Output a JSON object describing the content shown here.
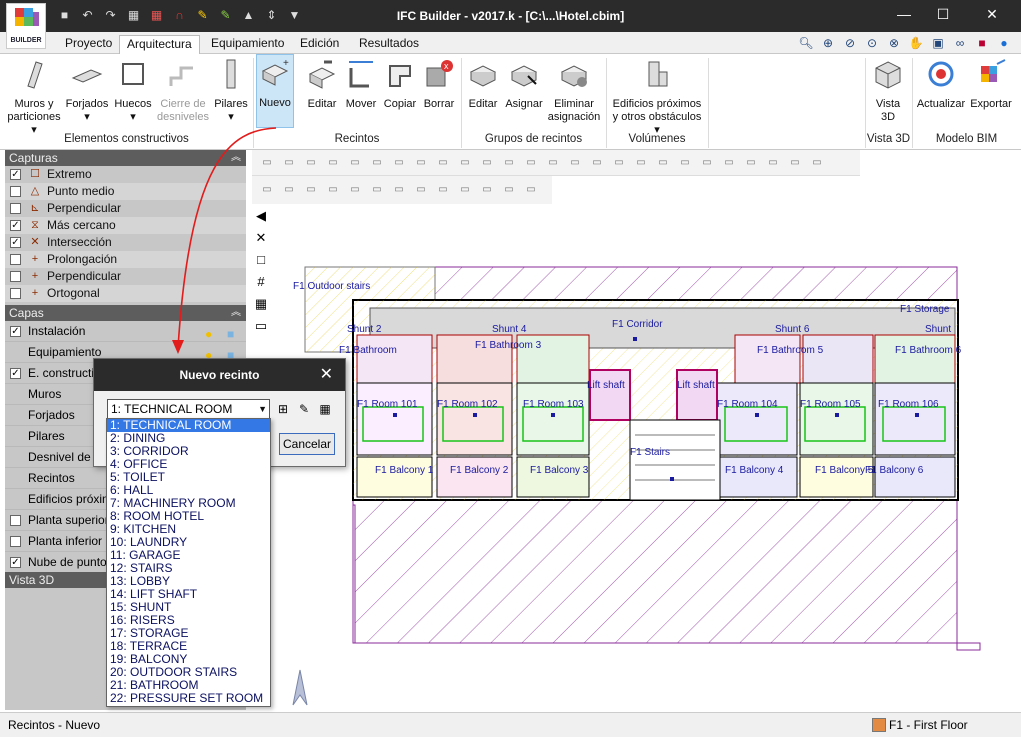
{
  "window": {
    "title": "IFC Builder - v2017.k - [C:\\...\\Hotel.cbim]",
    "logo_text": "BUILDER"
  },
  "menu_tabs": [
    "Proyecto",
    "Arquitectura",
    "Equipamiento",
    "Edición",
    "Resultados"
  ],
  "active_tab": "Arquitectura",
  "ribbon": {
    "buttons": {
      "muros": "Muros y\nparticiones",
      "forjados": "Forjados",
      "huecos": "Huecos",
      "cierre": "Cierre de\ndesniveles",
      "pilares": "Pilares",
      "nuevo": "Nuevo",
      "editar": "Editar",
      "mover": "Mover",
      "copiar": "Copiar",
      "borrar": "Borrar",
      "g_editar": "Editar",
      "asignar": "Asignar",
      "eliminar": "Eliminar\nasignación",
      "edificios": "Edificios próximos\ny otros obstáculos",
      "vista3d": "Vista\n3D",
      "actualizar": "Actualizar",
      "exportar": "Exportar"
    },
    "groups": {
      "elementos": "Elementos constructivos",
      "recintos": "Recintos",
      "grupos": "Grupos de recintos",
      "volumenes": "Volúmenes cercanos",
      "vista3d": "Vista 3D",
      "modelo": "Modelo BIM"
    }
  },
  "capturas": {
    "title": "Capturas",
    "items": [
      {
        "label": "Extremo",
        "checked": true,
        "icon": "square-snap-icon"
      },
      {
        "label": "Punto medio",
        "checked": false,
        "icon": "triangle-snap-icon"
      },
      {
        "label": "Perpendicular",
        "checked": false,
        "icon": "perpendicular-snap-icon"
      },
      {
        "label": "Más cercano",
        "checked": true,
        "icon": "hourglass-snap-icon"
      },
      {
        "label": "Intersección",
        "checked": true,
        "icon": "x-snap-icon"
      },
      {
        "label": "Prolongación",
        "checked": false,
        "icon": "plus-snap-icon"
      },
      {
        "label": "Perpendicular",
        "checked": false,
        "icon": "plus-snap-icon"
      },
      {
        "label": "Ortogonal",
        "checked": false,
        "icon": "plus-snap-icon"
      }
    ]
  },
  "capas": {
    "title": "Capas",
    "items": [
      {
        "label": "Instalación",
        "checked": true,
        "has_cb": true
      },
      {
        "label": "Equipamiento",
        "checked": false,
        "has_cb": false
      },
      {
        "label": "E. constructivos",
        "checked": true,
        "has_cb": true
      },
      {
        "label": "Muros",
        "checked": false,
        "has_cb": false
      },
      {
        "label": "Forjados",
        "checked": false,
        "has_cb": false
      },
      {
        "label": "Pilares",
        "checked": false,
        "has_cb": false
      },
      {
        "label": "Desnivel de forjados",
        "checked": false,
        "has_cb": false
      },
      {
        "label": "Recintos",
        "checked": false,
        "has_cb": false
      },
      {
        "label": "Edificios próximos",
        "checked": false,
        "has_cb": false
      },
      {
        "label": "Planta superior",
        "checked": false,
        "has_cb": true
      },
      {
        "label": "Planta inferior",
        "checked": false,
        "has_cb": true
      },
      {
        "label": "Nube de puntos",
        "checked": true,
        "has_cb": true
      }
    ]
  },
  "vista3d_panel": "Vista 3D",
  "dialog": {
    "title": "Nuevo recinto",
    "selected": "1: TECHNICAL ROOM",
    "cancel": "Cancelar",
    "options": [
      "1: TECHNICAL ROOM",
      "2: DINING",
      "3: CORRIDOR",
      "4: OFFICE",
      "5: TOILET",
      "6: HALL",
      "7: MACHINERY ROOM",
      "8: ROOM HOTEL",
      "9: KITCHEN",
      "10: LAUNDRY",
      "11: GARAGE",
      "12: STAIRS",
      "13: LOBBY",
      "14: LIFT SHAFT",
      "15: SHUNT",
      "16: RISERS",
      "17: STORAGE",
      "18: TERRACE",
      "19: BALCONY",
      "20: OUTDOOR STAIRS",
      "21: BATHROOM",
      "22: PRESSURE SET ROOM"
    ]
  },
  "plan": {
    "outdoor_stairs": "F1 Outdoor stairs",
    "corridor": "F1 Corridor",
    "stairs": "F1 Stairs",
    "lift1": "Lift shaft",
    "lift2": "Lift shaft",
    "shunt2": "Shunt 2",
    "shunt4": "Shunt 4",
    "shunt6": "Shunt 6",
    "shunt_r": "Shunt",
    "storage": "F1 Storage",
    "bath1": "F1 Bathroom",
    "bath2": "F1 Bathroom 3",
    "bath3": "F1 Bathroom 5",
    "bath4": "F1 Bathroom 6",
    "rooms": [
      "F1 Room 101",
      "F1 Room 102",
      "F1 Room 103",
      "F1 Room 104",
      "F1 Room 105",
      "F1 Room 106"
    ],
    "balconies": [
      "F1 Balcony 1",
      "F1 Balcony 2",
      "F1 Balcony 3",
      "F1 Balcony 4",
      "F1 Balcony 5",
      "F1 Balcony 6"
    ]
  },
  "status": {
    "left": "Recintos - Nuevo",
    "right": "F1 - First Floor"
  }
}
